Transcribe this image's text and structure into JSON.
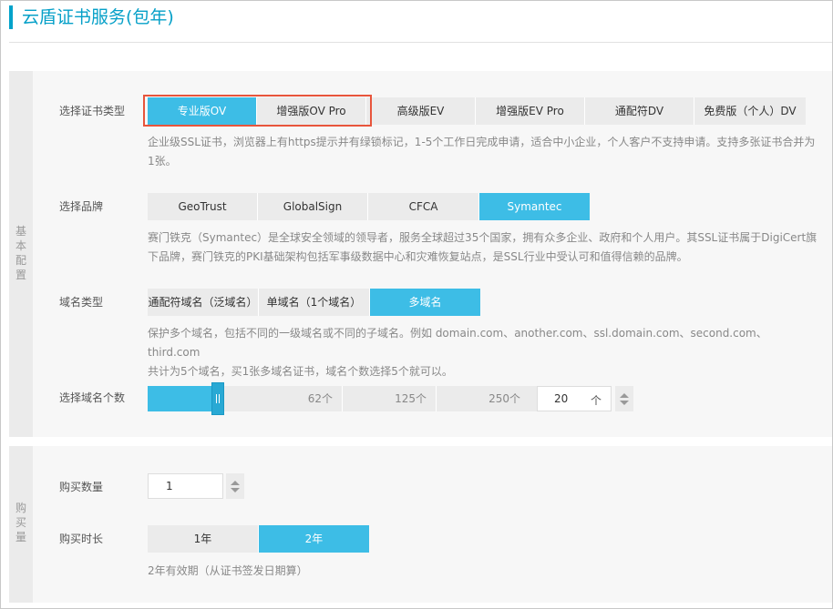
{
  "page_title": "云盾证书服务(包年)",
  "basic": {
    "side_label": [
      "基",
      "本",
      "配",
      "置"
    ],
    "cert_type": {
      "label": "选择证书类型",
      "options": [
        "专业版OV",
        "增强版OV Pro",
        "高级版EV",
        "增强版EV Pro",
        "通配符DV",
        "免费版（个人）DV"
      ],
      "selected": "专业版OV",
      "desc": [
        "企业级SSL证书，浏览器上有https提示并有绿锁标记，1-5个工作日完成申请，适合中小企业，个人客户不支持申请。支持多张证书合并为",
        "1张。"
      ]
    },
    "brand": {
      "label": "选择品牌",
      "options": [
        "GeoTrust",
        "GlobalSign",
        "CFCA",
        "Symantec"
      ],
      "selected": "Symantec",
      "desc": [
        "赛门铁克（Symantec）是全球安全领域的领导者，服务全球超过35个国家，拥有众多企业、政府和个人用户。其SSL证书属于DigiCert旗",
        "下品牌，赛门铁克的PKI基础架构包括军事级数据中心和灾难恢复站点，是SSL行业中受认可和值得信赖的品牌。"
      ]
    },
    "domain_type": {
      "label": "域名类型",
      "options": [
        "通配符域名（泛域名）",
        "单域名（1个域名）",
        "多域名"
      ],
      "selected": "多域名",
      "desc": [
        "保护多个域名，包括不同的一级域名或不同的子域名。例如 domain.com、another.com、ssl.domain.com、second.com、third.com",
        "共计为5个域名，买1张多域名证书，域名个数选择5个就可以。"
      ]
    },
    "domain_count": {
      "label": "选择域名个数",
      "ticks": [
        "62个",
        "125个",
        "250个"
      ],
      "value": "20",
      "unit": "个",
      "slider_fraction": 0.18
    }
  },
  "purchase": {
    "side_label": [
      "购",
      "买",
      "量"
    ],
    "quantity": {
      "label": "购买数量",
      "value": "1"
    },
    "duration": {
      "label": "购买时长",
      "options": [
        "1年",
        "2年"
      ],
      "selected": "2年",
      "note": "2年有效期（从证书签发日期算）"
    }
  },
  "colors": {
    "accent": "#3dbde6",
    "highlight_border": "#e8553c",
    "title": "#06a0c8"
  }
}
